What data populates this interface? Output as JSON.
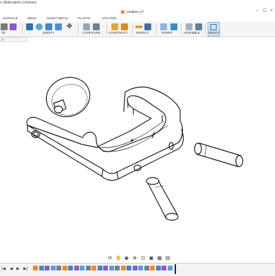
{
  "window": {
    "app_title": "n (Education License)",
    "doc_tab": "Untitled v1*",
    "controls": [
      "minimize-icon",
      "maximize-icon",
      "close-icon"
    ]
  },
  "ribbon": {
    "tabs": [
      "SURFACE",
      "MESH",
      "SHEET METAL",
      "PLASTIC",
      "UTILITIES"
    ],
    "groups": [
      "TE",
      "MODIFY",
      "CONFIGURE",
      "CONSTRUCT",
      "INSPECT",
      "INSERT",
      "ASSEMBLE",
      "SELECT"
    ]
  },
  "browser": {
    "label": "≡"
  },
  "nav_bar": {
    "items": [
      "orbit-icon",
      "pan-icon",
      "look-at-icon",
      "zoom-icon",
      "fit-icon",
      "display-settings-icon",
      "grid-icon",
      "viewport-icon"
    ]
  },
  "timeline": {
    "controls": [
      "|◀",
      "◀",
      "▶",
      "▶|"
    ],
    "item_count": 24,
    "accent": "#f08a24"
  },
  "colors": {
    "ribbon_bg": "#f5f5f5",
    "select_highlight": "#cfe3f5",
    "model_line": "#1a1a1a"
  }
}
